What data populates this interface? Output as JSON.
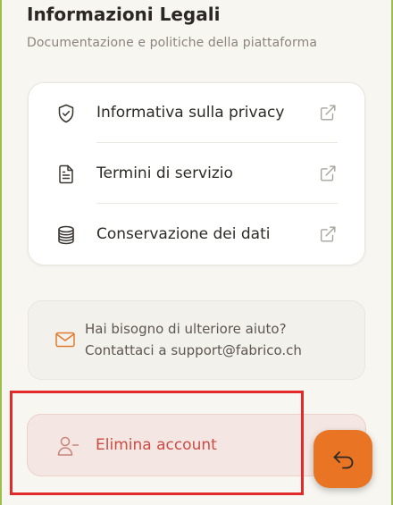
{
  "header": {
    "title": "Informazioni Legali",
    "subtitle": "Documentazione e politiche della piattaforma"
  },
  "legal_links": [
    {
      "label": "Informativa sulla privacy",
      "icon": "shield-check-icon",
      "action_icon": "external-link-icon"
    },
    {
      "label": "Termini di servizio",
      "icon": "document-icon",
      "action_icon": "external-link-icon"
    },
    {
      "label": "Conservazione dei dati",
      "icon": "database-icon",
      "action_icon": "external-link-icon"
    }
  ],
  "help": {
    "line1": "Hai bisogno di ulteriore aiuto?",
    "line2": "Contattaci a support@fabrico.ch",
    "icon": "mail-icon"
  },
  "delete_account": {
    "label": "Elimina account",
    "icon": "user-minus-icon"
  },
  "fab": {
    "icon": "return-arrow-icon"
  },
  "colors": {
    "accent": "#e97424",
    "danger_text": "#cc4b44",
    "danger_bg": "#f4e6e2",
    "page_bg": "#f7f6f1",
    "highlight": "#e22a2a"
  }
}
